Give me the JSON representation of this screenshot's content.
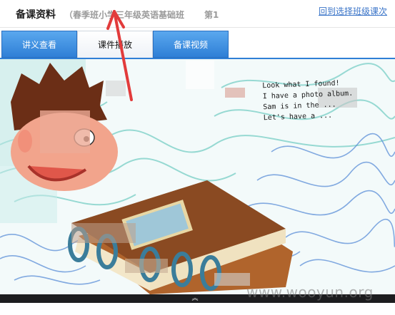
{
  "header": {
    "title": "备课资料",
    "course": "（春季班小学三年级英语基础班",
    "lesson_prefix": "第1",
    "back_link": "回到选择班级课次"
  },
  "tabs": [
    {
      "label": "讲义查看",
      "state": "default"
    },
    {
      "label": "课件播放",
      "state": "active"
    },
    {
      "label": "备课视频",
      "state": "default"
    }
  ],
  "stage": {
    "speech": [
      "Look what I found!",
      "I have a photo album.",
      "Sam is in the ...",
      "Let's have a ..."
    ]
  },
  "watermark": "www.wooyun.org",
  "colors": {
    "tab_blue": "#2f7fd6",
    "link_blue": "#3a74c8",
    "book_brown": "#8a4a22",
    "scribble_blue": "#5b8fd8",
    "scribble_teal": "#7fd1c9",
    "annotation_red": "#e23b3b"
  },
  "icons": {
    "expand": "chevron-up-icon"
  }
}
